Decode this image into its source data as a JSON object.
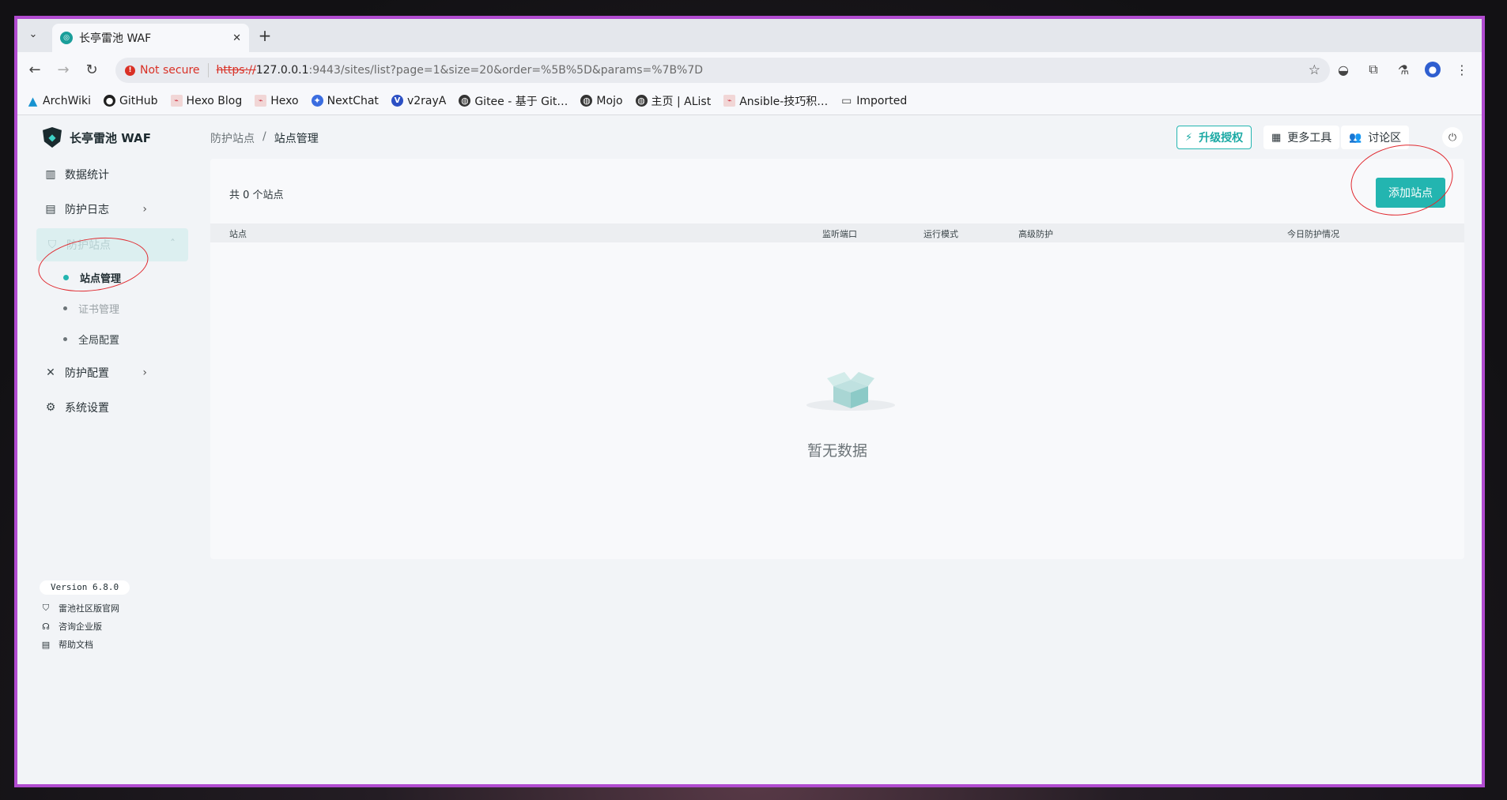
{
  "browser": {
    "tab_title": "长亭雷池 WAF",
    "not_secure": "Not secure",
    "url_scheme": "https://",
    "url_host": "127.0.0.1",
    "url_rest": ":9443/sites/list?page=1&size=20&order=%5B%5D&params=%7B%7D",
    "bookmarks": [
      "ArchWiki",
      "GitHub",
      "Hexo Blog",
      "Hexo",
      "NextChat",
      "v2rayA",
      "Gitee - 基于 Git…",
      "Mojo",
      "主页 | AList",
      "Ansible-技巧积…",
      "Imported"
    ]
  },
  "brand": {
    "name": "长亭雷池 WAF"
  },
  "menu": {
    "stats": "数据统计",
    "logs": "防护日志",
    "sites": "防护站点",
    "site_manage": "站点管理",
    "cert_manage": "证书管理",
    "global_config": "全局配置",
    "protect_config": "防护配置",
    "system_settings": "系统设置"
  },
  "footer": {
    "version": "Version 6.8.0",
    "community": "雷池社区版官网",
    "enterprise": "咨询企业版",
    "docs": "帮助文档"
  },
  "header": {
    "breadcrumb_parent": "防护站点",
    "breadcrumb_sep": "/",
    "breadcrumb_current": "站点管理",
    "upgrade": "升级授权",
    "more_tools": "更多工具",
    "forum": "讨论区"
  },
  "content": {
    "count": "共 0 个站点",
    "add_button": "添加站点",
    "columns": [
      "站点",
      "监听端口",
      "运行模式",
      "高级防护",
      "今日防护情况"
    ],
    "empty": "暂无数据"
  },
  "colors": {
    "accent": "#23b5b0",
    "frame": "#b14bd0",
    "annotation": "#e0282e"
  }
}
